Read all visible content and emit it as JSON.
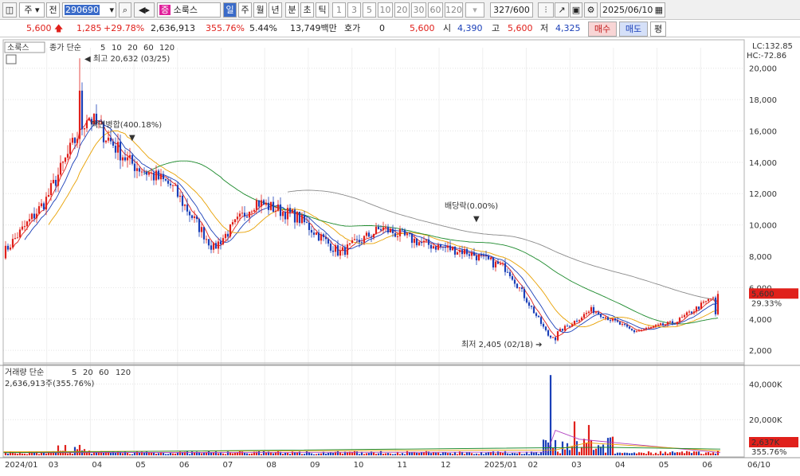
{
  "toolbar": {
    "type_label": "주",
    "prev_label": "전",
    "code": "290690",
    "stock_badge": "증",
    "stock_name": "소룩스",
    "periods": [
      "일",
      "주",
      "월",
      "년",
      "분",
      "초",
      "틱"
    ],
    "numbers": [
      "1",
      "3",
      "5",
      "10",
      "20",
      "30",
      "60",
      "120"
    ],
    "count": "327",
    "total": "/600",
    "date": "2025/06/10"
  },
  "quote": {
    "price": "5,600",
    "change": "1,285",
    "change_pct": "+29.78%",
    "volume": "2,636,913",
    "volume_pct": "355.76%",
    "turnover": "5.44%",
    "amount": "13,749백만",
    "hoga_label": "호가",
    "hoga_value": "0",
    "hoga_price": "5,600",
    "open_label": "시",
    "open": "4,390",
    "high_label": "고",
    "high": "5,600",
    "low_label": "저",
    "low": "4,325",
    "buy_label": "매수",
    "sell_label": "매도",
    "eval_label": "평"
  },
  "price_panel": {
    "name_tag": "소룩스",
    "legend_title": "종가 단순",
    "ma": [
      "5",
      "10",
      "20",
      "60",
      "120"
    ],
    "lc": "LC:132.85",
    "hc": "HC:-72.86",
    "last_price": "5,600",
    "last_pct": "29.33%",
    "annotations": {
      "high": "최고 20,632 (03/25)",
      "split": "액면병합(400.18%)",
      "dividend": "배당락(0.00%)",
      "low": "최저 2,405 (02/18)"
    }
  },
  "volume_panel": {
    "legend_title": "거래량 단순",
    "ma": [
      "5",
      "20",
      "60",
      "120"
    ],
    "current": "2,636,913주(355.76%)",
    "last_value": "2,637K",
    "last_pct": "355.76%"
  },
  "colors": {
    "up": "#e0201b",
    "down": "#1a3fb8",
    "ma5": "#e0201b",
    "ma10": "#1a3fb8",
    "ma20": "#e8a000",
    "ma60": "#1c8a2c",
    "ma120": "#8a8a8a",
    "vol_ma5": "#b040c0",
    "vol_ma20": "#e8a000",
    "vol_ma60": "#1c8a2c",
    "vol_ma120": "#8a8a8a"
  },
  "chart_data": {
    "type": "candlestick",
    "price_y_ticks": [
      "20,000",
      "18,000",
      "16,000",
      "14,000",
      "12,000",
      "10,000",
      "8,000",
      "6,000",
      "4,000",
      "2,000"
    ],
    "price_ylim": [
      1500,
      21000
    ],
    "volume_y_ticks": [
      "40,000K",
      "20,000K"
    ],
    "volume_ylim": [
      0,
      50000
    ],
    "x_labels": [
      "2024/01",
      "03",
      "04",
      "05",
      "06",
      "07",
      "08",
      "09",
      "10",
      "11",
      "12",
      "2025/01",
      "02",
      "03",
      "04",
      "05",
      "06",
      "06/10"
    ],
    "monthly_close_approx": [
      {
        "month": "2024/01",
        "close": 8200
      },
      {
        "month": "2024/02",
        "close": 11500
      },
      {
        "month": "2024/03",
        "close": 17000
      },
      {
        "month": "2024/04",
        "close": 14000
      },
      {
        "month": "2024/05",
        "close": 12500
      },
      {
        "month": "2024/06",
        "close": 8500
      },
      {
        "month": "2024/07",
        "close": 11500
      },
      {
        "month": "2024/08",
        "close": 10500
      },
      {
        "month": "2024/09",
        "close": 8200
      },
      {
        "month": "2024/10",
        "close": 9800
      },
      {
        "month": "2024/11",
        "close": 8800
      },
      {
        "month": "2024/12",
        "close": 8300
      },
      {
        "month": "2025/01",
        "close": 7200
      },
      {
        "month": "2025/02",
        "close": 2800
      },
      {
        "month": "2025/03",
        "close": 4600
      },
      {
        "month": "2025/04",
        "close": 3200
      },
      {
        "month": "2025/05",
        "close": 3800
      },
      {
        "month": "2025/06",
        "close": 5600
      }
    ],
    "high_point": {
      "value": 20632,
      "date": "03/25"
    },
    "low_point": {
      "value": 2405,
      "date": "02/18"
    }
  }
}
